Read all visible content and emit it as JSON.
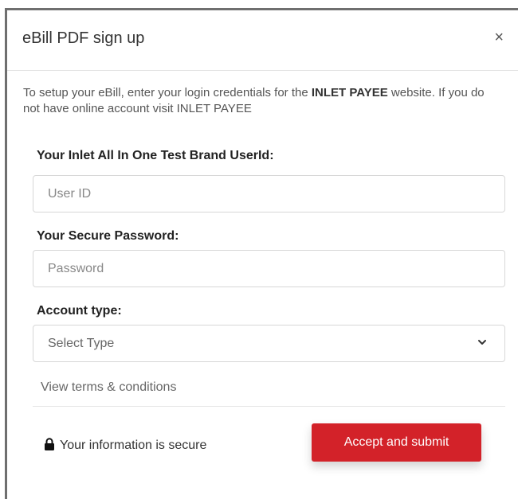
{
  "modal": {
    "title": "eBill PDF sign up",
    "close_glyph": "×",
    "intro_before_bold1": "To setup your eBill, enter your login credentials for the ",
    "intro_bold1": "INLET PAYEE",
    "intro_after_bold1": " website. If you do not have online account visit INLET PAYEE"
  },
  "form": {
    "userid_label": "Your Inlet All In One Test Brand UserId:",
    "userid_placeholder": "User ID",
    "userid_value": "",
    "password_label": "Your Secure Password:",
    "password_placeholder": "Password",
    "password_value": "",
    "account_type_label": "Account type:",
    "account_type_selected": "Select Type",
    "terms_link": "View terms & conditions"
  },
  "footer": {
    "secure_text": "Your information is secure",
    "submit_label": "Accept and submit"
  },
  "icons": {
    "close": "close-icon",
    "lock": "lock-icon",
    "chevron": "chevron-down-icon"
  },
  "colors": {
    "accent": "#d32229",
    "frame": "#6f6f6f"
  }
}
